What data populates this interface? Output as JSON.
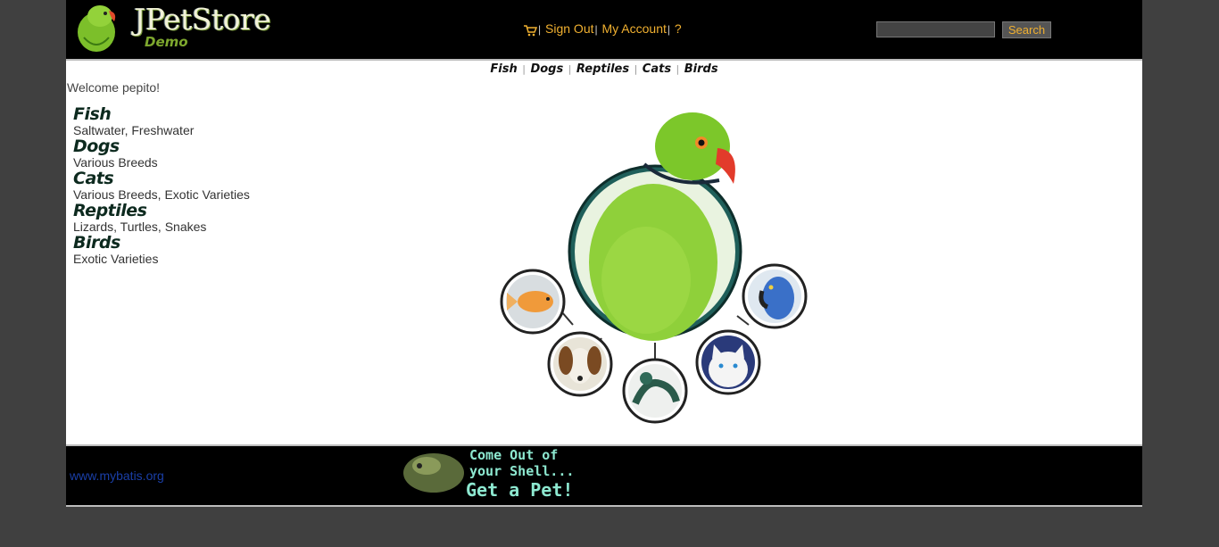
{
  "header": {
    "logo_title": "JPetStore",
    "logo_subtitle": "Demo",
    "menu": {
      "cart_icon": "cart-icon",
      "sign_out": "Sign Out",
      "my_account": "My Account",
      "help": "?",
      "separator": "|"
    },
    "search": {
      "value": "",
      "button_label": "Search"
    }
  },
  "quick_links": [
    "Fish",
    "Dogs",
    "Reptiles",
    "Cats",
    "Birds"
  ],
  "welcome": "Welcome pepito!",
  "categories": [
    {
      "name": "Fish",
      "description": "Saltwater, Freshwater"
    },
    {
      "name": "Dogs",
      "description": "Various Breeds"
    },
    {
      "name": "Cats",
      "description": "Various Breeds, Exotic Varieties"
    },
    {
      "name": "Reptiles",
      "description": "Lizards, Turtles, Snakes"
    },
    {
      "name": "Birds",
      "description": "Exotic Varieties"
    }
  ],
  "footer": {
    "link": "www.mybatis.org",
    "banner_lines": [
      "Come Out of",
      "your Shell...",
      "Get a Pet!"
    ]
  },
  "colors": {
    "page_bg": "#404040",
    "header_bg": "#000000",
    "menu_link": "#f0b030",
    "footer_link": "#1a3fa8"
  }
}
